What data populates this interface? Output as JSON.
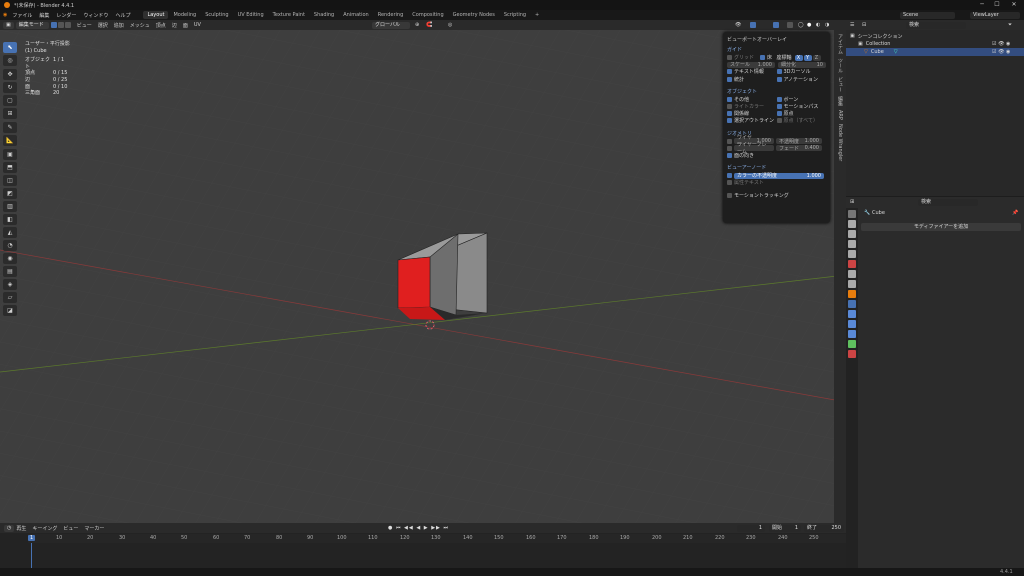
{
  "window": {
    "title": "*(未保存) - Blender 4.4.1",
    "logo_icon": "blender-logo-icon",
    "min": "─",
    "max": "☐",
    "close": "✕"
  },
  "topbar": {
    "menus": [
      "ファイル",
      "編集",
      "レンダー",
      "ウィンドウ",
      "ヘルプ"
    ],
    "workspaces": [
      "Layout",
      "Modeling",
      "Sculpting",
      "UV Editing",
      "Texture Paint",
      "Shading",
      "Animation",
      "Rendering",
      "Compositing",
      "Geometry Nodes",
      "Scripting"
    ],
    "add_tab": "+",
    "scene": "Scene",
    "view_layer": "ViewLayer"
  },
  "viewport_header": {
    "mode": "編集モード",
    "menus": [
      "ビュー",
      "選択",
      "追加",
      "メッシュ",
      "頂点",
      "辺",
      "面",
      "UV"
    ],
    "transform": "グローバル"
  },
  "stats": {
    "view": "ユーザー・平行投影",
    "object": "(1) Cube",
    "rows": [
      {
        "label": "オブジェクト",
        "value": "1 / 1"
      },
      {
        "label": "頂点",
        "value": "0 / 15"
      },
      {
        "label": "辺",
        "value": "0 / 25"
      },
      {
        "label": "面",
        "value": "0 / 10"
      },
      {
        "label": "三角面",
        "value": "20"
      }
    ]
  },
  "overlay": {
    "title": "ビューポートオーバーレイ",
    "guides": {
      "heading": "ガイド",
      "grid": "グリッド",
      "floor": "床",
      "axes": "座標軸",
      "x": "X",
      "y": "Y",
      "z": "Z",
      "scale_label": "スケール",
      "scale_value": "1.000",
      "subdiv_label": "細分化",
      "subdiv_value": "10",
      "text_info": "テキスト情報",
      "cursor3d": "3Dカーソル",
      "stats": "統計",
      "annotation": "アノテーション"
    },
    "objects": {
      "heading": "オブジェクト",
      "extras": "その他",
      "bones": "ボーン",
      "light_colors": "ライトカラー",
      "motion_paths": "モーションパス",
      "relations": "関係線",
      "origins": "原点",
      "outline": "選択アウトライン",
      "origins_all": "原点（すべて）"
    },
    "geometry": {
      "heading": "ジオメトリ",
      "wire_label": "ワイヤー",
      "wire_value": "1.000",
      "opacity_label": "不透明度",
      "opacity_value": "1.000",
      "fade_label": "フェード",
      "fade_value": "0.400",
      "wireframe": "ワイヤーフレーム",
      "face_orientation": "面の向き"
    },
    "viewer": {
      "heading": "ビューアーノード",
      "color_opacity": "カラーの不透明度",
      "color_value": "1.000",
      "attr_text": "属性テキスト"
    },
    "motion_tracking": "モーショントラッキング"
  },
  "sidetabs": [
    "アイテム",
    "ツール",
    "ビュー",
    "編集",
    "ARP",
    "Node Wrangler"
  ],
  "timeline": {
    "menus": [
      "再生",
      "キーイング",
      "ビュー",
      "マーカー"
    ],
    "current": "1",
    "start_label": "開始",
    "start": "1",
    "end_label": "終了",
    "end": "250",
    "ticks": [
      "1",
      "10",
      "20",
      "30",
      "40",
      "50",
      "60",
      "70",
      "80",
      "90",
      "100",
      "110",
      "120",
      "130",
      "140",
      "150",
      "160",
      "170",
      "180",
      "190",
      "200",
      "210",
      "220",
      "230",
      "240",
      "250"
    ]
  },
  "outliner": {
    "root": "シーンコレクション",
    "collection": "Collection",
    "object": "Cube",
    "search": "検索"
  },
  "properties": {
    "search": "検索",
    "object": "Cube",
    "add_modifier": "モディファイアーを追加"
  },
  "status": {
    "version": "4.4.1"
  },
  "colors": {
    "accent": "#4772b3",
    "face_selected": "#e01f1f",
    "mesh": "#8b8b8b"
  }
}
